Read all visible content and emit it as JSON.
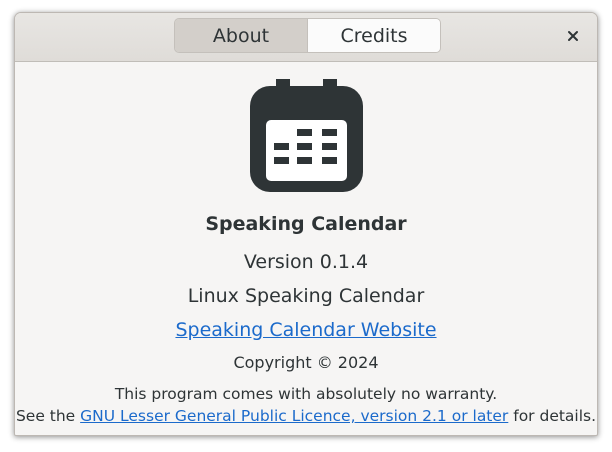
{
  "header": {
    "tabs": [
      {
        "label": "About",
        "active": true
      },
      {
        "label": "Credits",
        "active": false
      }
    ],
    "close_icon": "close-icon"
  },
  "about": {
    "logo_icon": "calendar-icon",
    "app_name": "Speaking Calendar",
    "version": "Version 0.1.4",
    "comments": "Linux Speaking Calendar",
    "website_label": "Speaking Calendar Website",
    "copyright": "Copyright © 2024",
    "license_line1": "This program comes with absolutely no warranty.",
    "license_prefix": "See the ",
    "license_link": "GNU Lesser General Public Licence, version 2.1 or later",
    "license_suffix": " for details."
  },
  "colors": {
    "link": "#1b6acb",
    "text": "#2e3436",
    "window_bg": "#f6f5f4",
    "icon": "#2e3436"
  }
}
